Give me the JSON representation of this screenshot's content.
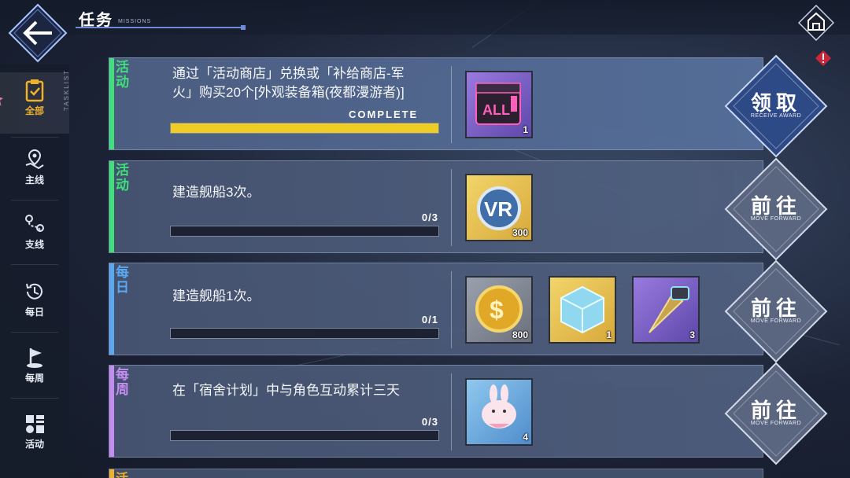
{
  "header": {
    "title": "任务",
    "subtitle": "MISSIONS"
  },
  "sidebar": {
    "vertical_label": "TASKLIST",
    "items": [
      {
        "label": "全部",
        "icon": "clipboard-icon",
        "active": true
      },
      {
        "label": "主线",
        "icon": "map-pin-icon",
        "active": false
      },
      {
        "label": "支线",
        "icon": "route-icon",
        "active": false
      },
      {
        "label": "每日",
        "icon": "clock-history-icon",
        "active": false
      },
      {
        "label": "每周",
        "icon": "flag-icon",
        "active": false
      },
      {
        "label": "活动",
        "icon": "grid-icon",
        "active": false
      }
    ]
  },
  "tasks": [
    {
      "tag": "活动",
      "tag_color": "#3fe07a",
      "description": "通过「活动商店」兑换或「补给商店-军火」购买20个[外观装备箱(夜都漫游者)]",
      "progress_text": "COMPLETE",
      "progress": 1.0,
      "rewards": [
        {
          "icon": "cosmetic-box-icon",
          "qty": "1"
        }
      ],
      "action": {
        "label": "领取",
        "sub": "RECEIVE AWARD"
      }
    },
    {
      "tag": "活动",
      "tag_color": "#3fe07a",
      "description": "建造舰船3次。",
      "progress_text": "0/3",
      "progress": 0,
      "rewards": [
        {
          "icon": "vr-token-icon",
          "qty": "300"
        }
      ],
      "action": {
        "label": "前往",
        "sub": "MOVE FORWARD"
      }
    },
    {
      "tag": "每日",
      "tag_color": "#59a8f0",
      "description": "建造舰船1次。",
      "progress_text": "0/1",
      "progress": 0,
      "rewards": [
        {
          "icon": "gold-coin-icon",
          "qty": "800"
        },
        {
          "icon": "ice-cube-icon",
          "qty": "1"
        },
        {
          "icon": "drill-icon",
          "qty": "3"
        }
      ],
      "action": {
        "label": "前往",
        "sub": "MOVE FORWARD"
      }
    },
    {
      "tag": "每周",
      "tag_color": "#c48cf0",
      "description": "在「宿舍计划」中与角色互动累计三天",
      "progress_text": "0/3",
      "progress": 0,
      "rewards": [
        {
          "icon": "bunny-plush-icon",
          "qty": "4"
        }
      ],
      "action": {
        "label": "前往",
        "sub": "MOVE FORWARD"
      }
    }
  ],
  "partial_row_tag": "活",
  "colors": {
    "complete_fill": "#f0cd24",
    "action_bg": "#2e4a86",
    "action_bg_alt": "#5a6680"
  }
}
